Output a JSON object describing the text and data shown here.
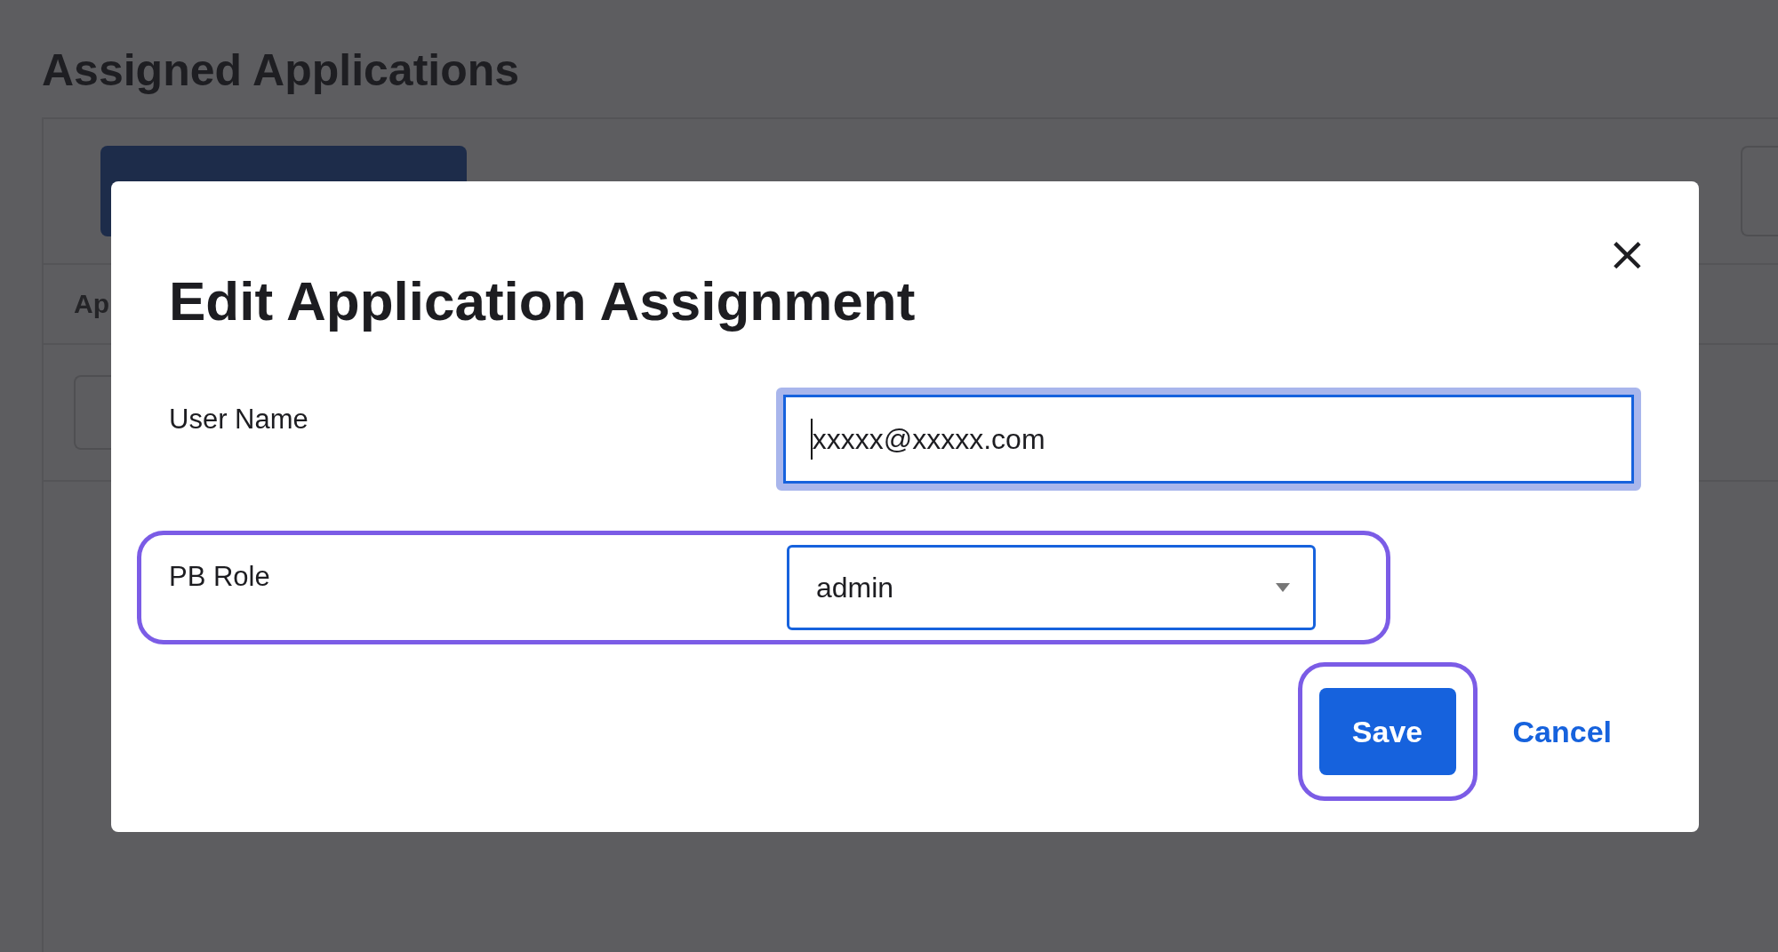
{
  "page": {
    "heading": "Assigned Applications",
    "column_1": "Ap"
  },
  "dialog": {
    "title": "Edit Application Assignment",
    "close": "×",
    "fields": [
      {
        "kind": "text",
        "label": "User Name",
        "value": "xxxxx@xxxxx.com",
        "focused": true,
        "highlighted": false
      },
      {
        "kind": "select",
        "label": "PB Role",
        "value": "admin",
        "focused": false,
        "highlighted": true
      }
    ],
    "buttons": [
      {
        "kind": "primary",
        "label": "Save",
        "highlighted": true
      },
      {
        "kind": "link",
        "label": "Cancel",
        "highlighted": false
      }
    ]
  }
}
